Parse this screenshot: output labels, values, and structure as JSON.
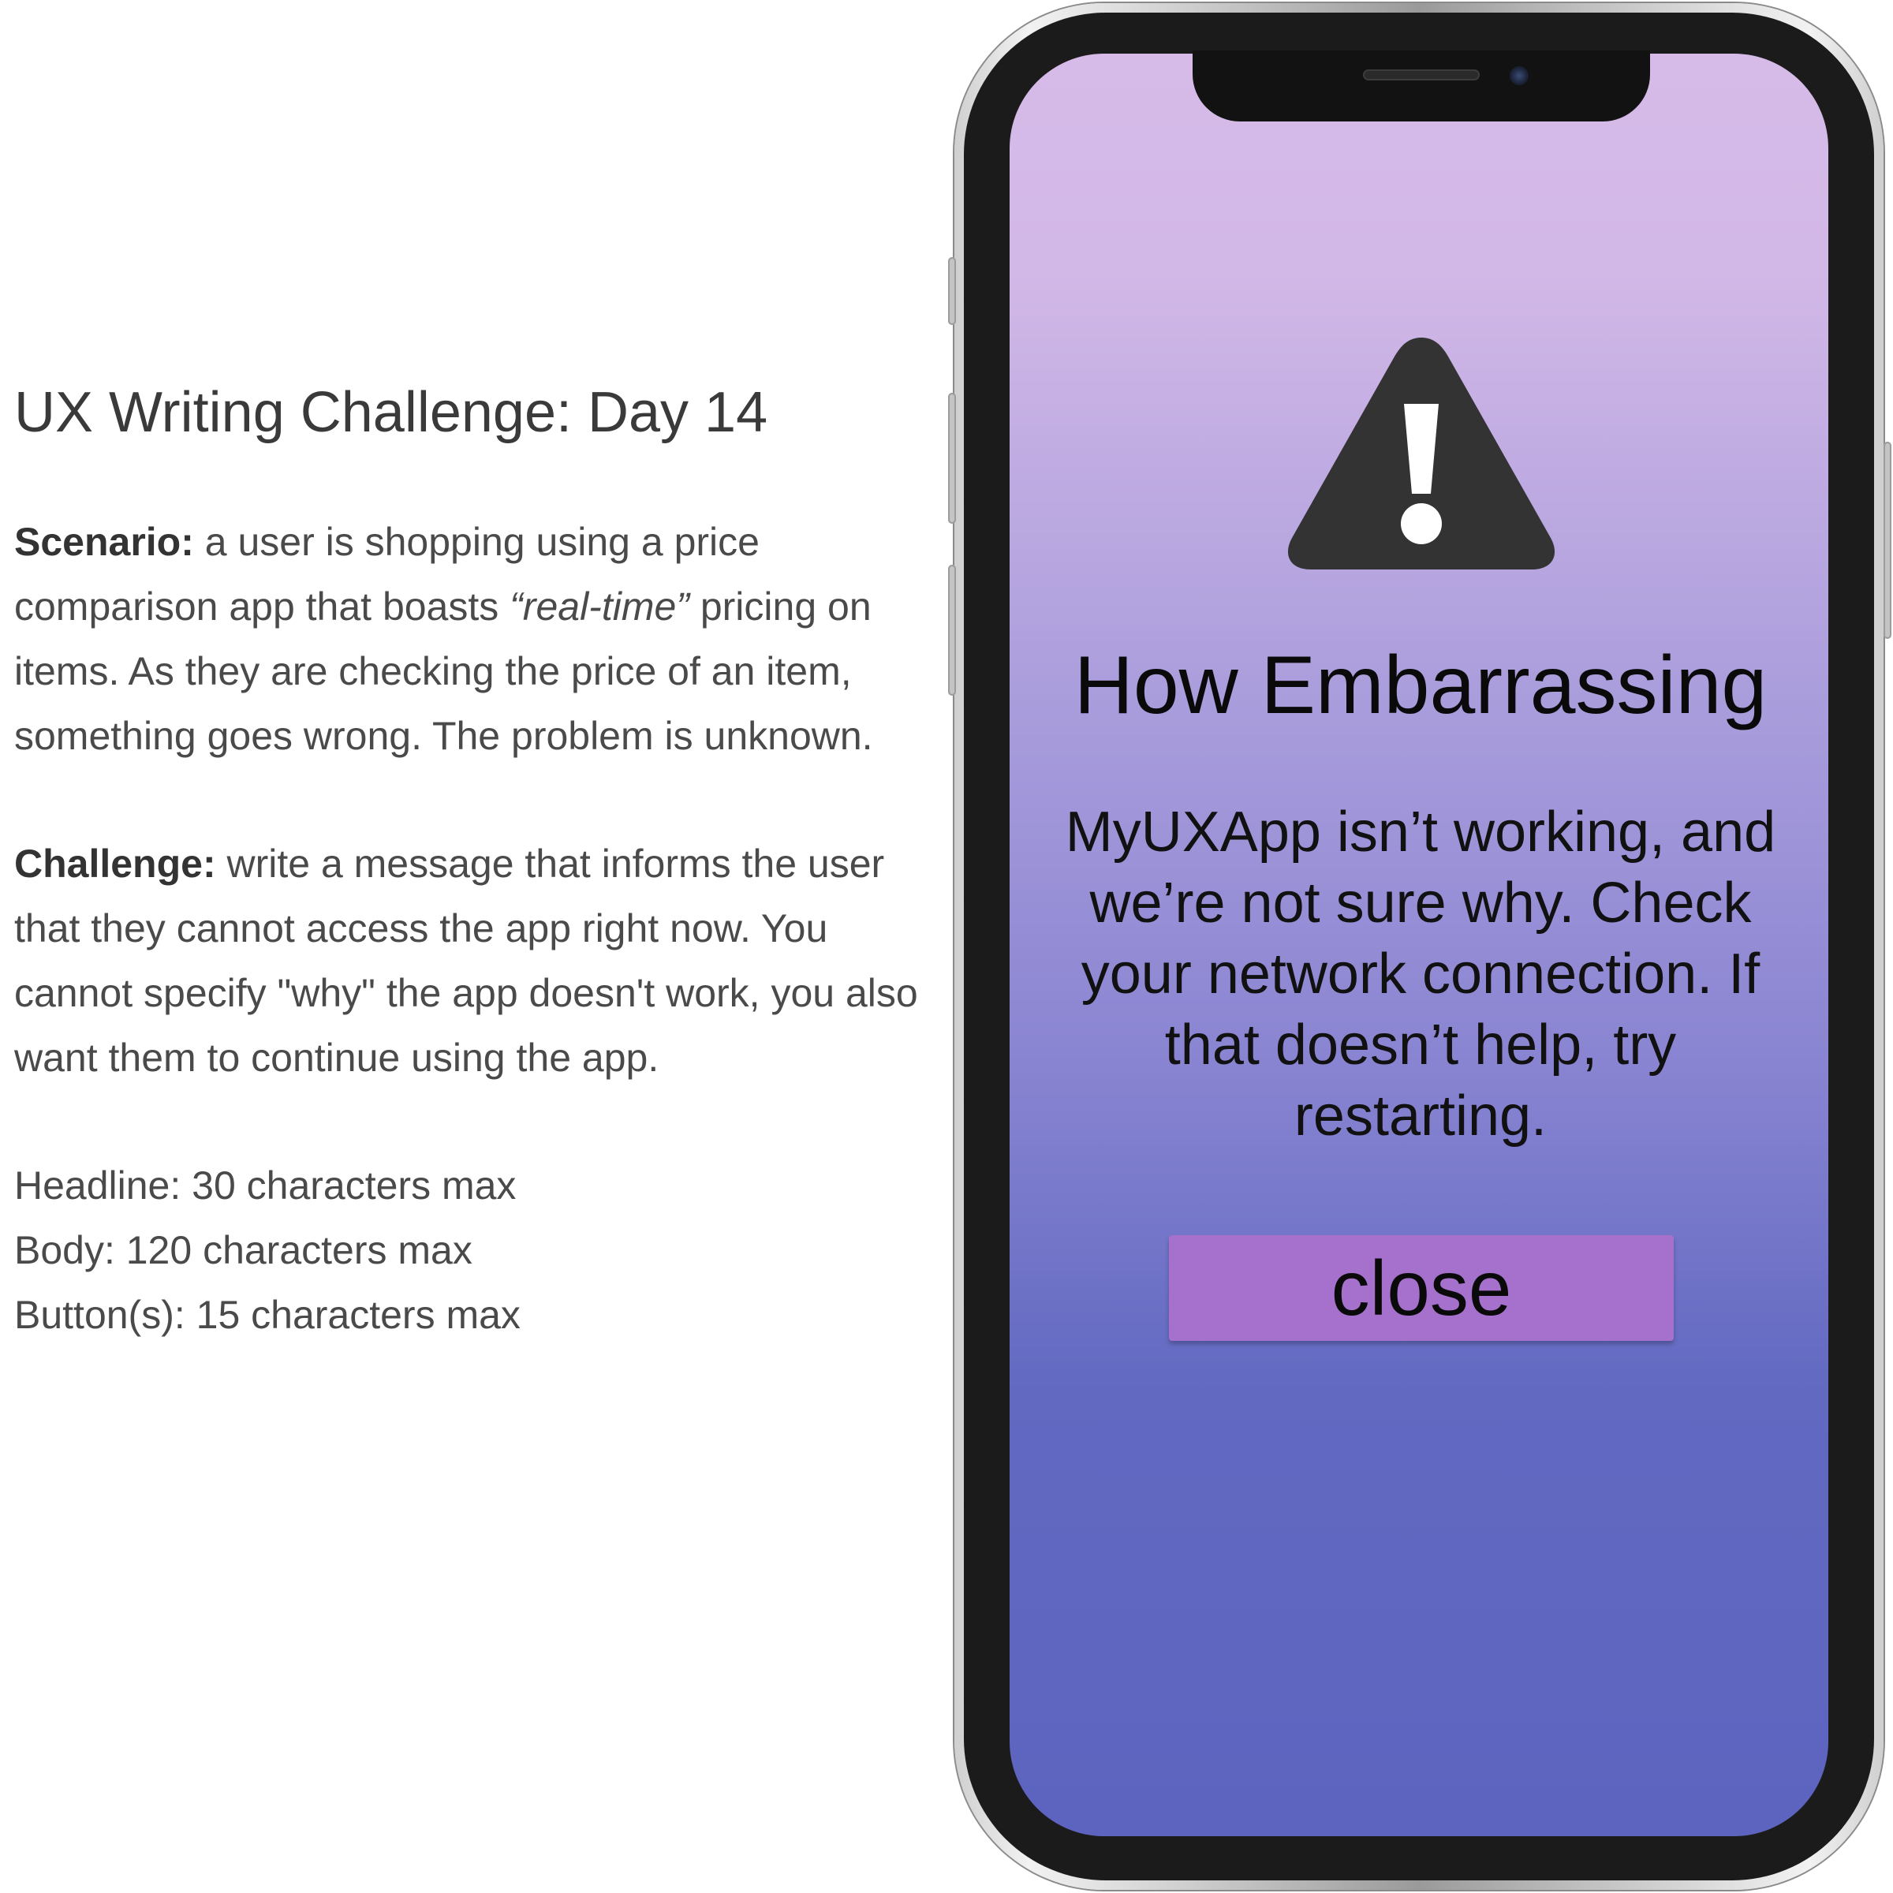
{
  "brief": {
    "title": "UX Writing Challenge: Day 14",
    "scenario_label": "Scenario:",
    "scenario_text_1": " a user is shopping using a price comparison app that boasts ",
    "scenario_emph": "“real-time”",
    "scenario_text_2": " pricing on items. As they are checking the price of an item, something goes wrong. The problem is unknown.",
    "challenge_label": "Challenge:",
    "challenge_text": " write a message that informs the user that they cannot access the app right now.  You cannot specify \"why\" the app doesn't work, you also want them to continue using the app.",
    "limits": [
      "Headline: 30 characters max",
      "Body: 120 characters max",
      "Button(s): 15 characters max"
    ]
  },
  "alert": {
    "icon": "warning-triangle-icon",
    "title": "How Embarrassing",
    "body": "MyUXApp isn’t working, and we’re not sure why. Check your network connection. If that doesn’t help, try restarting.",
    "button_label": "close"
  },
  "colors": {
    "button": "#a571cd",
    "gradient_top": "#d6bbe8",
    "gradient_bottom": "#5c64bf",
    "icon": "#333333"
  }
}
